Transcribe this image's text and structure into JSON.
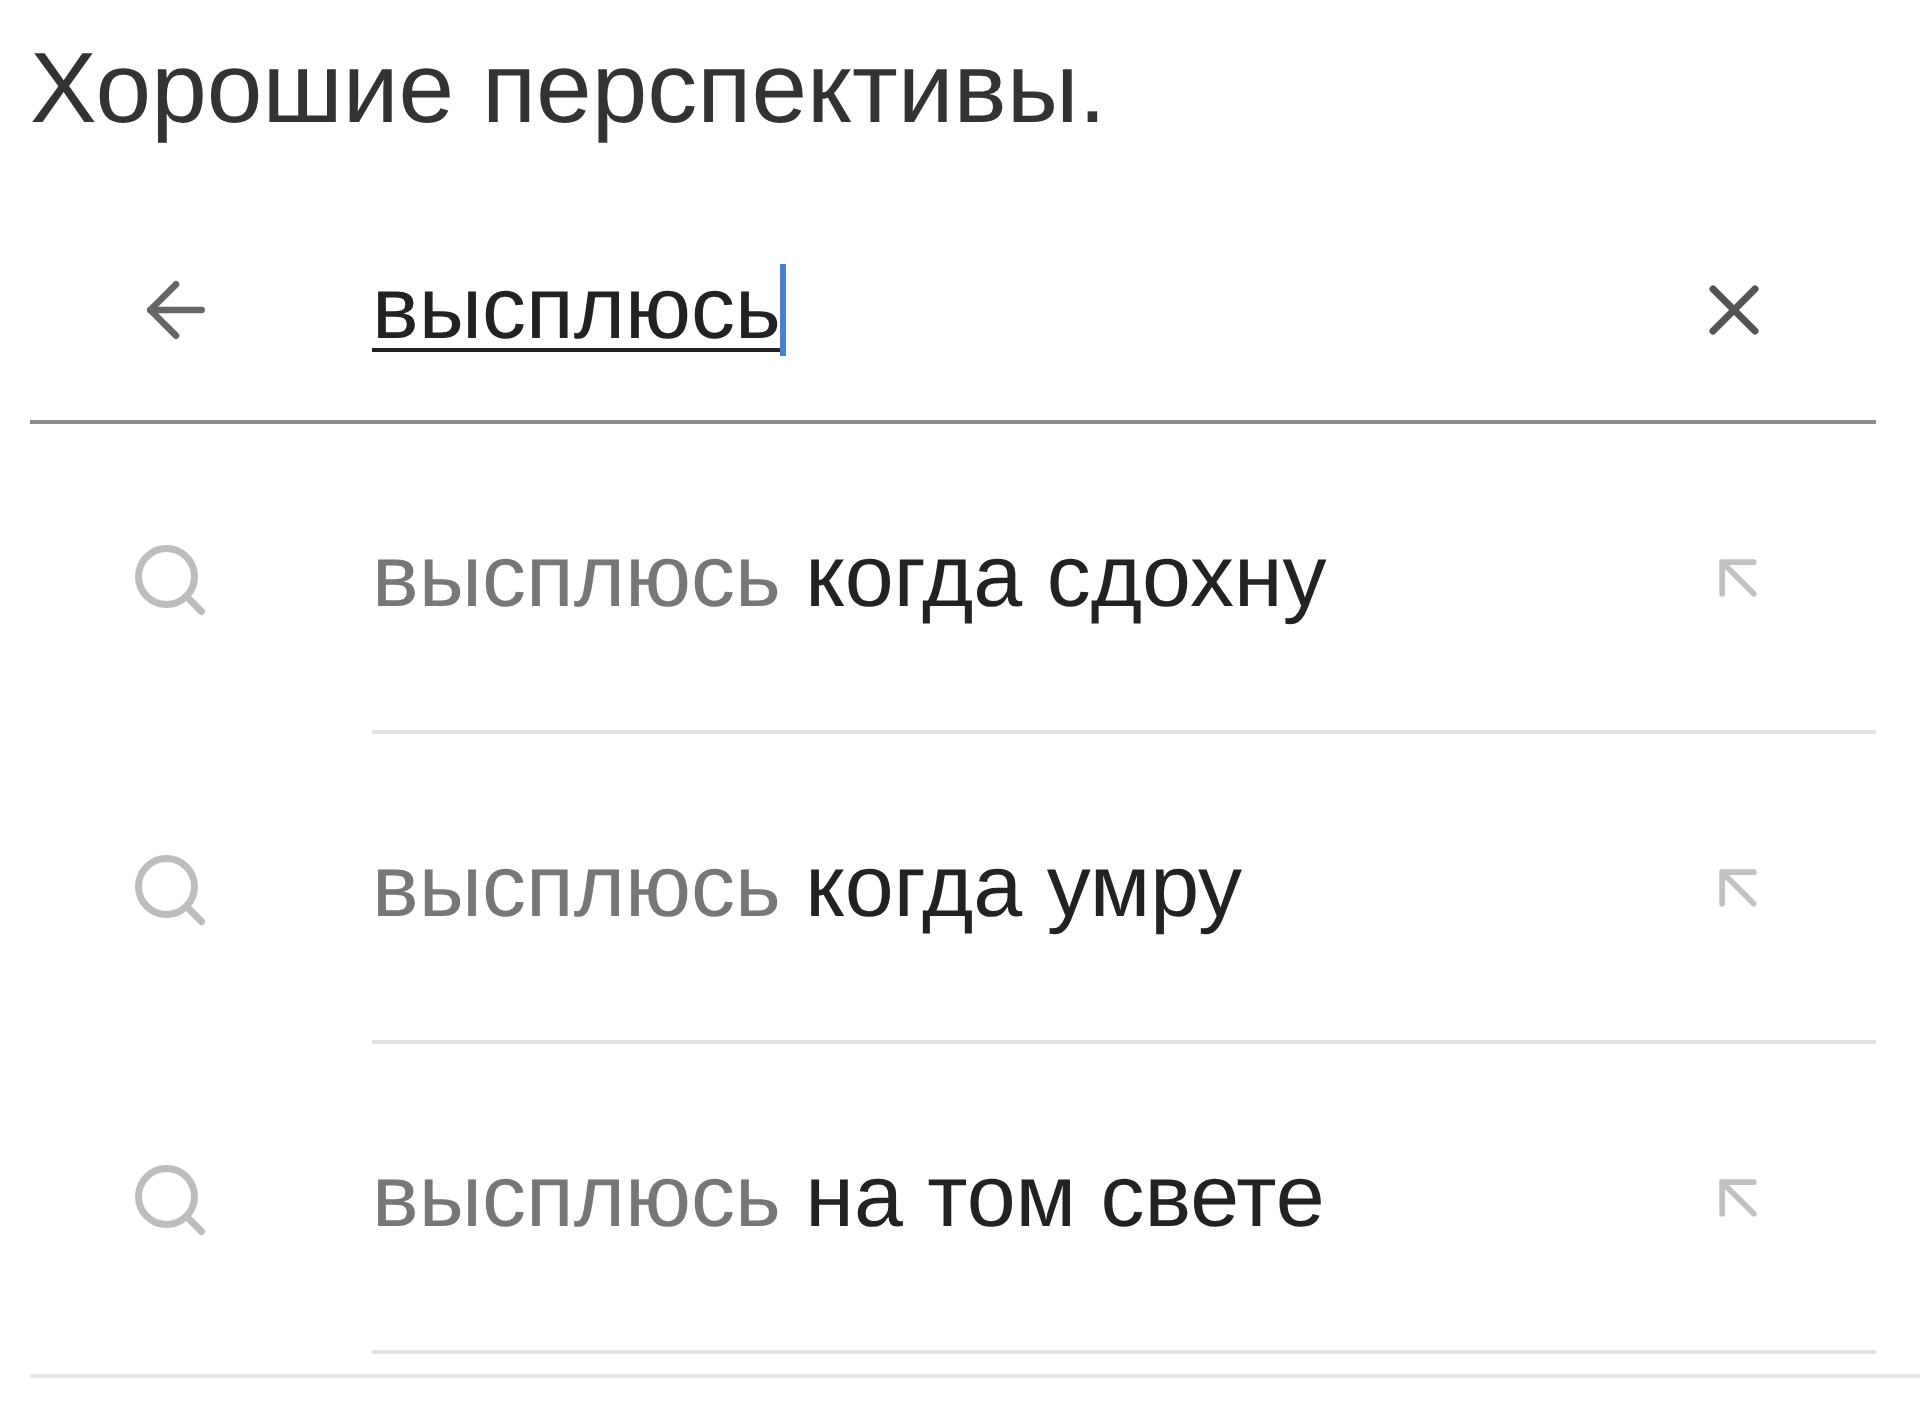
{
  "title": "Хорошие перспективы.",
  "search": {
    "value": "высплюсь",
    "focused": true
  },
  "suggestions": [
    {
      "query": "высплюсь",
      "completion": "когда сдохну"
    },
    {
      "query": "высплюсь",
      "completion": "когда умру"
    },
    {
      "query": "высплюсь",
      "completion": "на том свете"
    }
  ]
}
